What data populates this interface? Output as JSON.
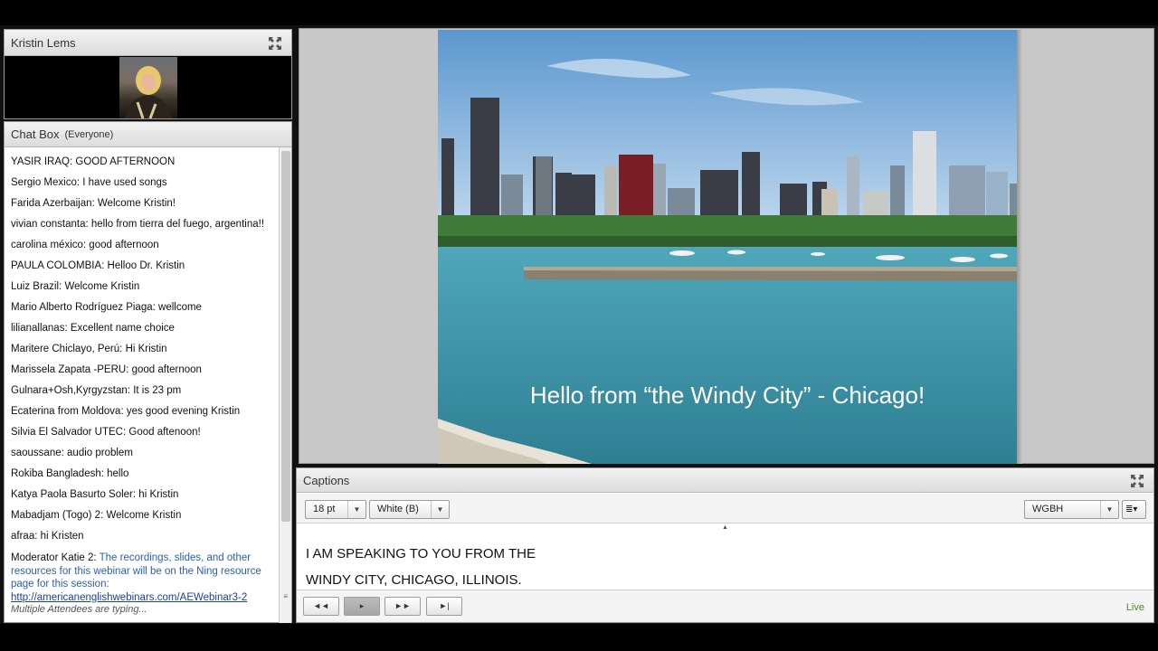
{
  "camera_pod": {
    "title": "Kristin Lems",
    "maximize_icon": "maximize-icon"
  },
  "chat_pod": {
    "title": "Chat Box",
    "audience": "(Everyone)",
    "messages": [
      {
        "sender": "YASIR IRAQ:",
        "text": "GOOD AFTERNOON"
      },
      {
        "sender": "Sergio Mexico:",
        "text": "I have used songs"
      },
      {
        "sender": "Farida Azerbaijan:",
        "text": "Welcome Kristin!"
      },
      {
        "sender": "vivian constanta:",
        "text": "hello from tierra del fuego, argentina!!"
      },
      {
        "sender": "carolina méxico:",
        "text": "good afternoon"
      },
      {
        "sender": "PAULA COLOMBIA:",
        "text": "Helloo Dr. Kristin"
      },
      {
        "sender": "Luiz Brazil:",
        "text": "Welcome Kristin"
      },
      {
        "sender": "Mario Alberto Rodríguez Piaga:",
        "text": "wellcome"
      },
      {
        "sender": "lilianallanas:",
        "text": "Excellent name choice"
      },
      {
        "sender": "Maritere Chiclayo, Perú:",
        "text": "Hi Kristin"
      },
      {
        "sender": "Marissela Zapata -PERU:",
        "text": "good afternoon"
      },
      {
        "sender": "Gulnara+Osh,Kyrgyzstan:",
        "text": "It is 23 pm"
      },
      {
        "sender": "Ecaterina from Moldova:",
        "text": "yes good evening Kristin"
      },
      {
        "sender": "Silvia El Salvador UTEC:",
        "text": "Good aftenoon!"
      },
      {
        "sender": "saoussane:",
        "text": "audio problem"
      },
      {
        "sender": "Rokiba Bangladesh:",
        "text": "hello"
      },
      {
        "sender": "Katya Paola Basurto Soler:",
        "text": "hi Kristin"
      },
      {
        "sender": "Mabadjam (Togo) 2:",
        "text": "Welcome Kristin"
      },
      {
        "sender": "afraa:",
        "text": "hi Kristen"
      }
    ],
    "moderator": {
      "sender": "Moderator Katie 2:",
      "text": "The recordings, slides, and other resources for this webinar will be on the Ning resource page for this session:",
      "link": "http://americanenglishwebinars.com/AEWebinar3-2"
    },
    "typing_status": "Multiple Attendees are typing..."
  },
  "slide": {
    "caption": "Hello from “the Windy City” - Chicago!"
  },
  "captions_pod": {
    "title": "Captions",
    "font_size": "18 pt",
    "color": "White (B)",
    "provider": "WGBH",
    "lines": [
      "I AM SPEAKING TO YOU FROM THE",
      "WINDY CITY, CHICAGO, ILLINOIS."
    ],
    "status": "Live"
  },
  "colors": {
    "link": "#1a3fa0",
    "moderator_text": "#2a5fb0",
    "live": "#4a8a20"
  }
}
